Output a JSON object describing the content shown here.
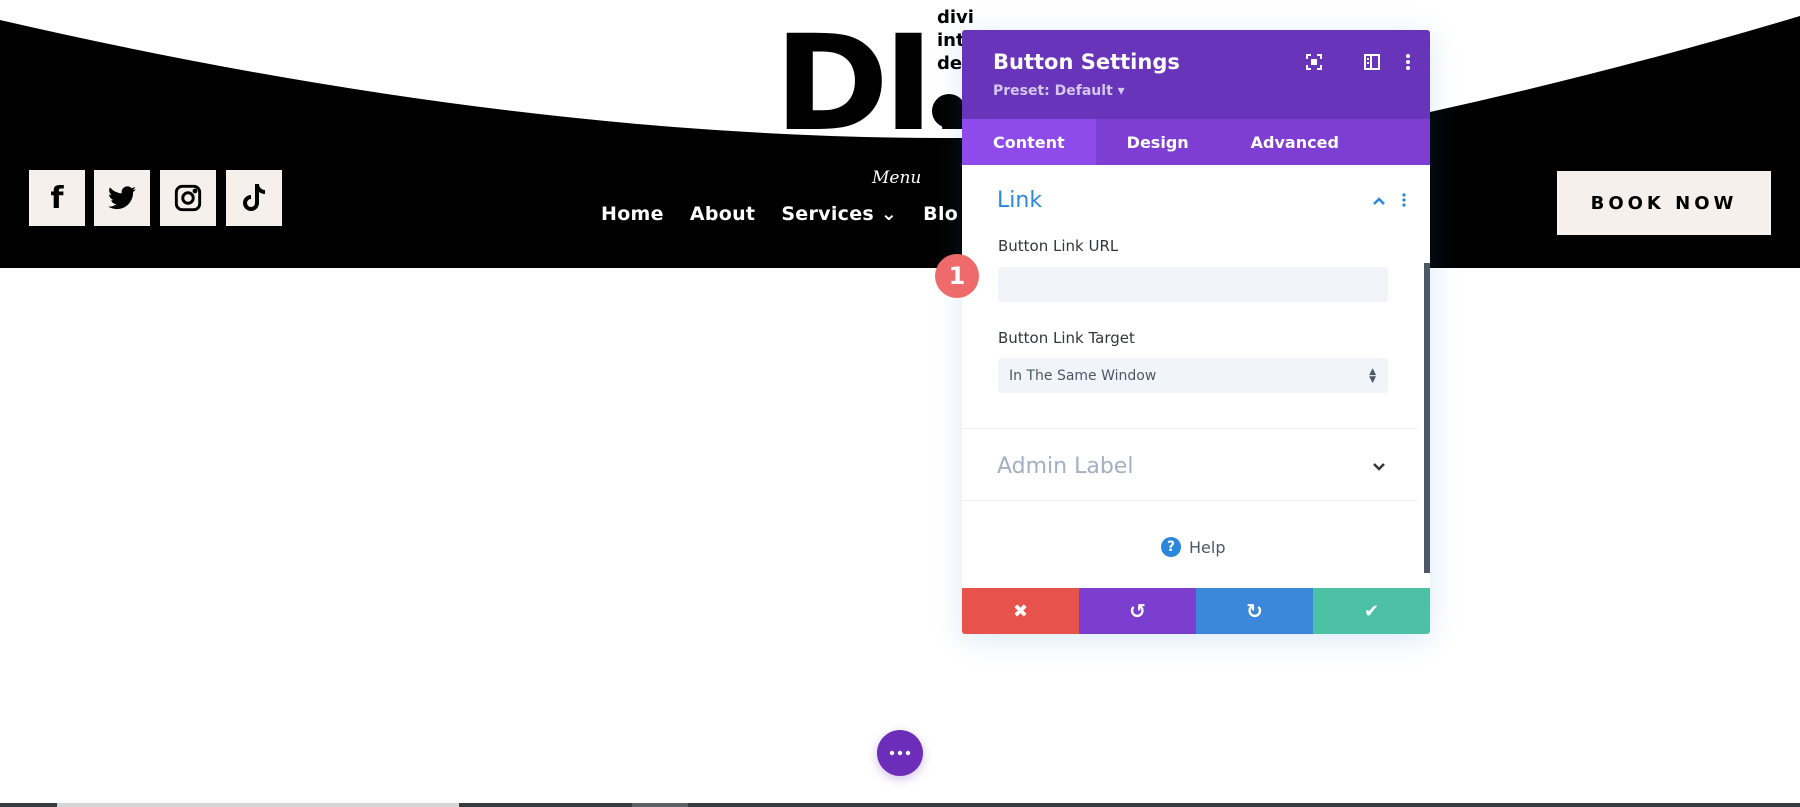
{
  "site": {
    "logo_letters": "DI.",
    "logo_small_lines": [
      "divi",
      "int",
      "de"
    ],
    "social": [
      "facebook-icon",
      "twitter-icon",
      "instagram-icon",
      "tiktok-icon"
    ],
    "menu_script": "Menu",
    "nav": [
      "Home",
      "About",
      "Services ⌄",
      "Blo"
    ],
    "book_now": "BOOK NOW"
  },
  "modal": {
    "title": "Button Settings",
    "preset": "Preset: Default ▾",
    "tabs": [
      "Content",
      "Design",
      "Advanced"
    ],
    "link_section": "Link",
    "url_label": "Button Link URL",
    "url_value": "",
    "target_label": "Button Link Target",
    "target_value": "In The Same Window",
    "admin_label": "Admin Label",
    "help": "Help"
  },
  "badge": "1",
  "colors": {
    "header": "#6734ba",
    "tabs": "#7e3ed4",
    "cancel": "#e7534c",
    "undo": "#7b3ecf",
    "redo": "#3b87da",
    "save": "#4dc1a6"
  }
}
